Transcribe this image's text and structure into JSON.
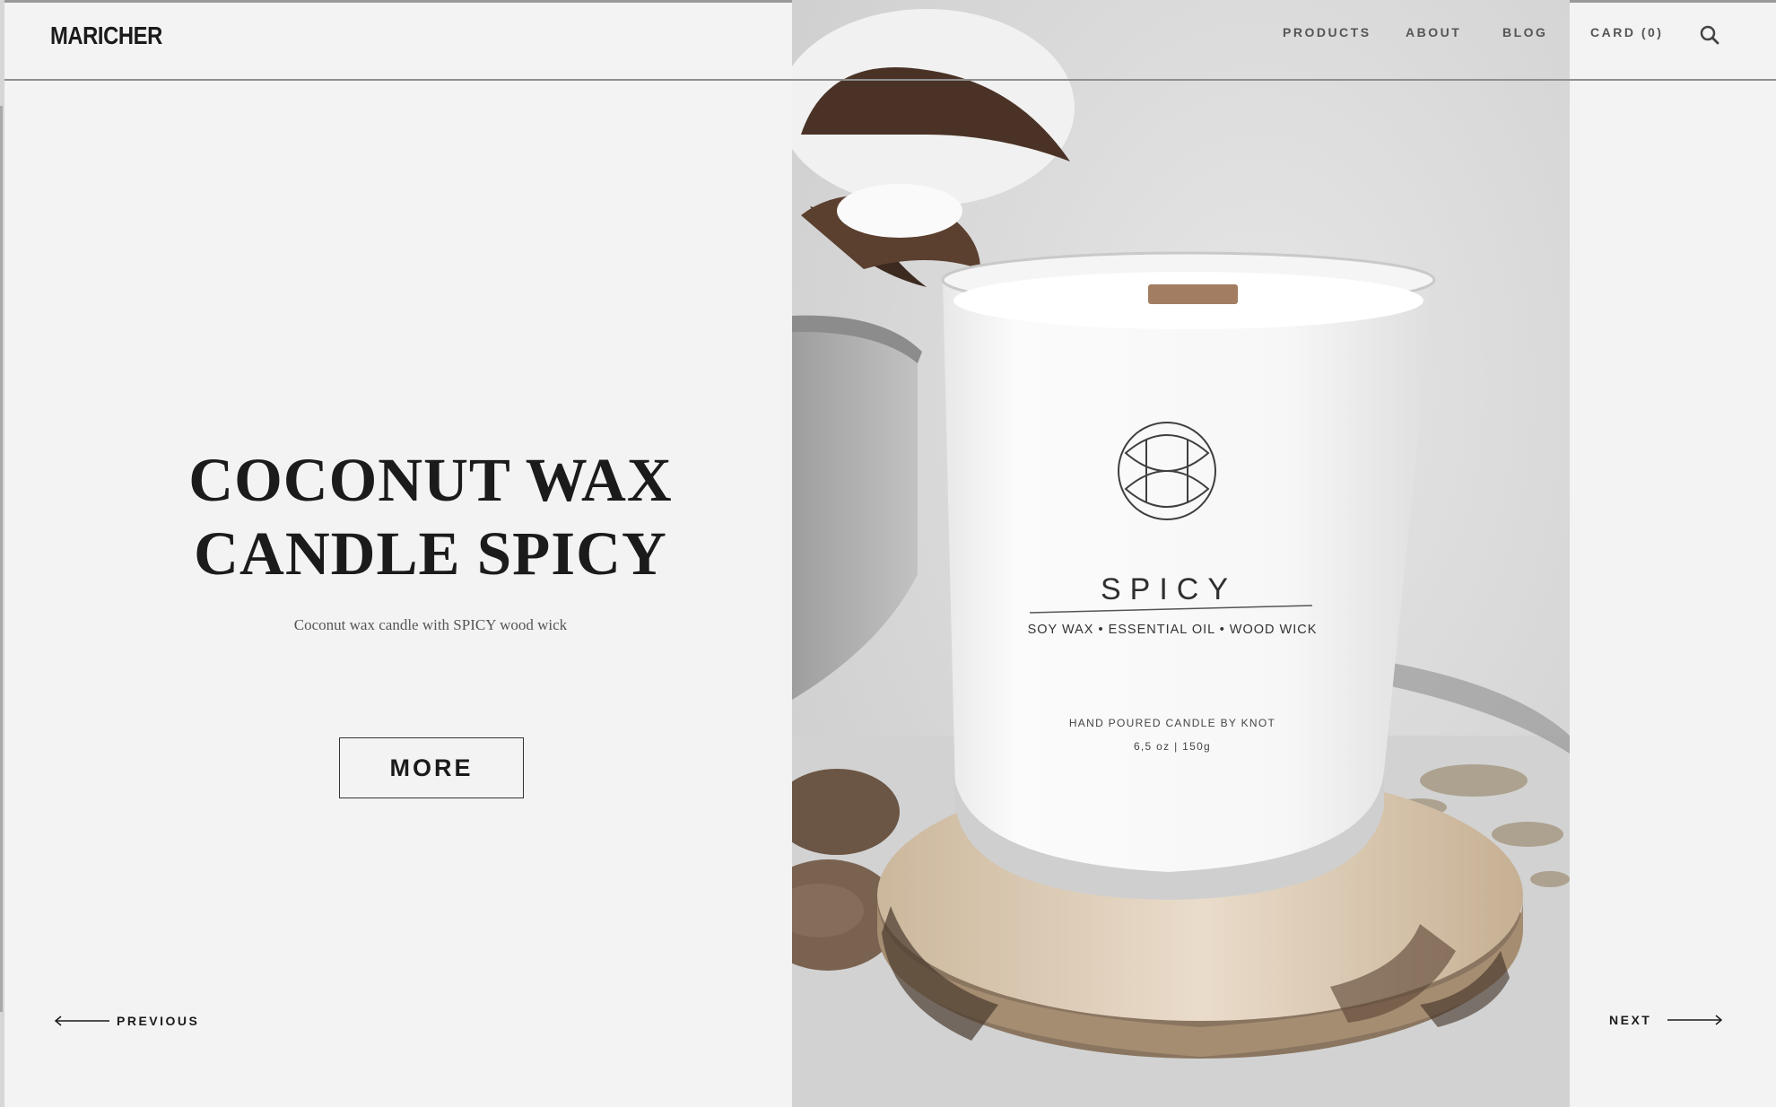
{
  "header": {
    "logo": "MARICHER",
    "nav": [
      {
        "label": "PRODUCTS"
      },
      {
        "label": "ABOUT"
      },
      {
        "label": "BLOG"
      },
      {
        "label": "CARD (0)"
      }
    ],
    "search_icon": "search-icon"
  },
  "hero": {
    "title_line1": "COCONUT WAX",
    "title_line2": "CANDLE SPICY",
    "subtitle": "Coconut wax candle with SPICY wood wick",
    "more_label": "MORE"
  },
  "image": {
    "candle_name": "SPICY",
    "candle_ingredients": "SOY WAX • ESSENTIAL OIL • WOOD WICK",
    "candle_maker": "HAND POURED CANDLE BY KNOT",
    "candle_weight": "6,5 oz | 150g"
  },
  "pager": {
    "previous_label": "PREVIOUS",
    "next_label": "NEXT"
  },
  "colors": {
    "background": "#f3f3f3",
    "text": "#1b1b1b",
    "nav_text": "#555555",
    "divider": "#8f8f8f"
  }
}
